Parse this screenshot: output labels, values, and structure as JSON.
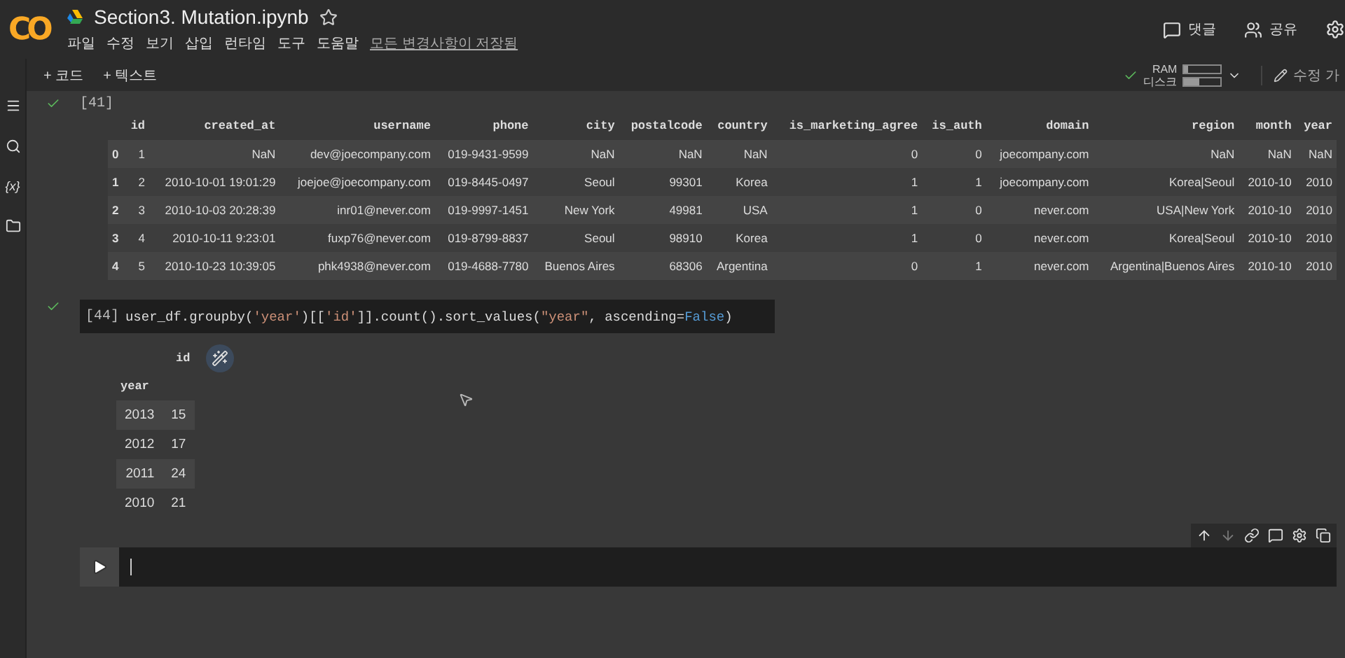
{
  "header": {
    "logo": "CO",
    "title": "Section3. Mutation.ipynb",
    "menu": [
      "파일",
      "수정",
      "보기",
      "삽입",
      "런타임",
      "도구",
      "도움말"
    ],
    "save_status": "모든 변경사항이 저장됨",
    "actions": [
      {
        "kind": "comment",
        "label": "댓글"
      },
      {
        "kind": "share",
        "label": "공유"
      }
    ]
  },
  "sidebar": {
    "variables_label": "{x}"
  },
  "toolbar": {
    "add_buttons": [
      "+ 코드",
      "+ 텍스트"
    ],
    "resources": [
      {
        "label": "RAM",
        "level": 0.1
      },
      {
        "label": "디스크",
        "level": 0.4
      }
    ],
    "connected": true,
    "edit_label": "수정 가"
  },
  "cells": [
    {
      "kind": "output",
      "counter": "[41]",
      "done": true,
      "table": {
        "columns": [
          "",
          "id",
          "created_at",
          "username",
          "phone",
          "city",
          "postalcode",
          "country",
          "is_marketing_agree",
          "is_auth",
          "domain",
          "region",
          "month",
          "year"
        ],
        "rows": [
          [
            "0",
            "1",
            "NaN",
            "dev@joecompany.com",
            "019-9431-9599",
            "NaN",
            "NaN",
            "NaN",
            "0",
            "0",
            "joecompany.com",
            "NaN",
            "NaN",
            "NaN"
          ],
          [
            "1",
            "2",
            "2010-10-01 19:01:29",
            "joejoe@joecompany.com",
            "019-8445-0497",
            "Seoul",
            "99301",
            "Korea",
            "1",
            "1",
            "joecompany.com",
            "Korea|Seoul",
            "2010-10",
            "2010"
          ],
          [
            "2",
            "3",
            "2010-10-03 20:28:39",
            "inr01@never.com",
            "019-9997-1451",
            "New York",
            "49981",
            "USA",
            "1",
            "0",
            "never.com",
            "USA|New York",
            "2010-10",
            "2010"
          ],
          [
            "3",
            "4",
            "2010-10-11 9:23:01",
            "fuxp76@never.com",
            "019-8799-8837",
            "Seoul",
            "98910",
            "Korea",
            "1",
            "0",
            "never.com",
            "Korea|Seoul",
            "2010-10",
            "2010"
          ],
          [
            "4",
            "5",
            "2010-10-23 10:39:05",
            "phk4938@never.com",
            "019-4688-7780",
            "Buenos Aires",
            "68306",
            "Argentina",
            "0",
            "1",
            "never.com",
            "Argentina|Buenos Aires",
            "2010-10",
            "2010"
          ]
        ]
      }
    },
    {
      "kind": "code",
      "counter": "[44]",
      "done": true,
      "code": [
        {
          "kind": "plain",
          "text": "user_df.groupby("
        },
        {
          "kind": "string",
          "text": "'year'"
        },
        {
          "kind": "plain",
          "text": ")[["
        },
        {
          "kind": "string",
          "text": "'id'"
        },
        {
          "kind": "plain",
          "text": "]].count().sort_values("
        },
        {
          "kind": "string",
          "text": "\"year\""
        },
        {
          "kind": "plain",
          "text": ", ascending="
        },
        {
          "kind": "keyword",
          "text": "False"
        },
        {
          "kind": "plain",
          "text": ")"
        }
      ],
      "result": {
        "column": "id",
        "index_name": "year",
        "rows": [
          [
            "2013",
            "15"
          ],
          [
            "2012",
            "17"
          ],
          [
            "2011",
            "24"
          ],
          [
            "2010",
            "21"
          ]
        ]
      }
    },
    {
      "kind": "empty"
    }
  ]
}
